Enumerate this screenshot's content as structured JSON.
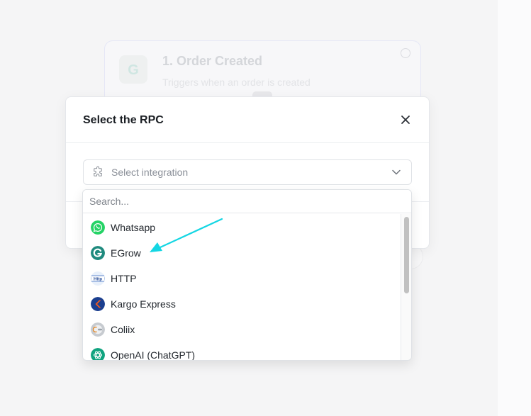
{
  "background": {
    "node_title": "1. Order Created",
    "node_subtitle": "Triggers when an order is created",
    "node_logo_letter": "G"
  },
  "modal": {
    "title": "Select the RPC",
    "select_placeholder": "Select integration"
  },
  "dropdown": {
    "search_placeholder": "Search...",
    "options": [
      {
        "label": "Whatsapp",
        "icon": "whatsapp-icon"
      },
      {
        "label": "EGrow",
        "icon": "egrow-icon"
      },
      {
        "label": "HTTP",
        "icon": "http-icon"
      },
      {
        "label": "Kargo Express",
        "icon": "kargo-express-icon"
      },
      {
        "label": "Coliix",
        "icon": "coliix-icon"
      },
      {
        "label": "OpenAI (ChatGPT)",
        "icon": "openai-icon"
      }
    ],
    "scroll_position": 0
  },
  "colors": {
    "annotation_arrow": "#14d6e3",
    "whatsapp": "#25d366",
    "egrow": "#1f8a7e",
    "kargo": "#1b3f8f",
    "openai": "#10a37f"
  },
  "icons": {
    "http_label": "Http"
  }
}
